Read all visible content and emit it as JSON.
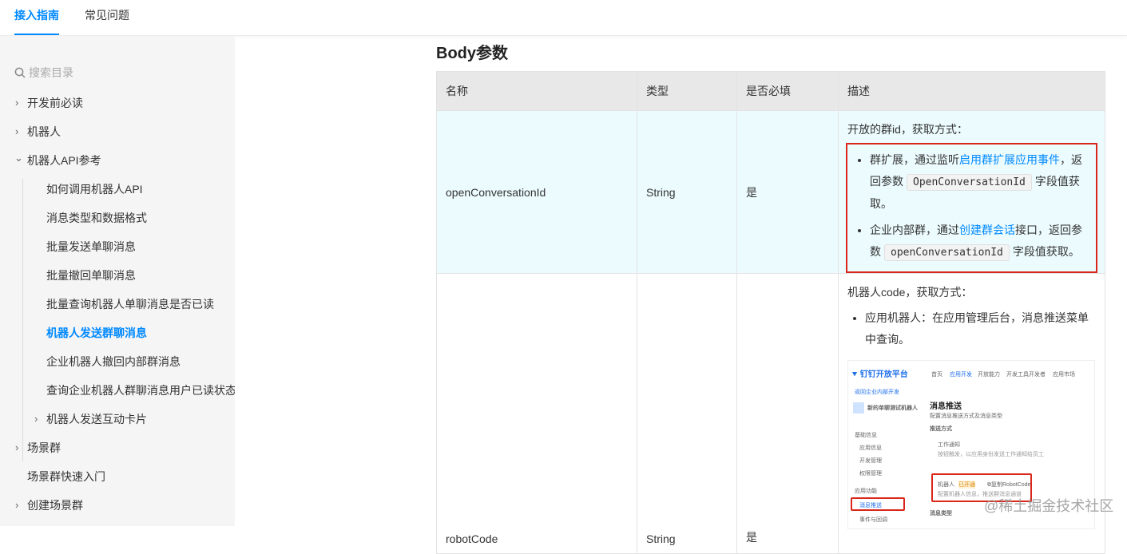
{
  "tabs": [
    {
      "label": "接入指南",
      "active": true
    },
    {
      "label": "常见问题",
      "active": false
    }
  ],
  "sidebar": {
    "search_placeholder": "搜索目录",
    "items": [
      {
        "label": "开发前必读",
        "chevron": "›"
      },
      {
        "label": "机器人",
        "chevron": "›"
      },
      {
        "label": "机器人API参考",
        "chevron": "⌄"
      },
      {
        "label": "如何调用机器人API"
      },
      {
        "label": "消息类型和数据格式"
      },
      {
        "label": "批量发送单聊消息"
      },
      {
        "label": "批量撤回单聊消息"
      },
      {
        "label": "批量查询机器人单聊消息是否已读"
      },
      {
        "label": "机器人发送群聊消息",
        "active": true
      },
      {
        "label": "企业机器人撤回内部群消息"
      },
      {
        "label": "查询企业机器人群聊消息用户已读状态"
      },
      {
        "label": "机器人发送互动卡片",
        "chevron": "›"
      },
      {
        "label": "场景群",
        "chevron": "›"
      },
      {
        "label": "场景群快速入门"
      },
      {
        "label": "创建场景群",
        "chevron": "›"
      }
    ]
  },
  "content": {
    "section_title": "Body参数",
    "headers": [
      "名称",
      "类型",
      "是否必填",
      "描述"
    ],
    "rows": [
      {
        "name": "openConversationId",
        "type": "String",
        "required": "是",
        "desc_head": "开放的群id，获取方式：",
        "bullets": [
          {
            "pre": "群扩展，通过监听",
            "link": "启用群扩展应用事件",
            "mid": "，返回参数",
            "code": "OpenConversationId",
            "post": "字段值获取。"
          },
          {
            "pre": "企业内部群，通过",
            "link": "创建群会话",
            "mid": "接口，返回参数",
            "code": "openConversationId",
            "post": "字段值获取。"
          }
        ]
      },
      {
        "name": "robotCode",
        "type": "String",
        "required": "是",
        "desc_head": "机器人code，获取方式：",
        "bullet": "应用机器人：在应用管理后台，消息推送菜单中查询。"
      }
    ]
  },
  "screenshot": {
    "logo": "钉钉开放平台",
    "nav": [
      "首页",
      "应用开发",
      "开放能力",
      "开发工具",
      "开发者",
      "应用市场"
    ],
    "back": "返回企业内部开发",
    "app_name": "新的单聊测试机器人",
    "menu": [
      "基础信息",
      "应用信息",
      "开发管理",
      "权限管理",
      "应用功能",
      "消息推送",
      "事件与回调"
    ],
    "heading": "消息推送",
    "subheading": "配置消息推送方式及消息类型",
    "section": "推送方式",
    "notice_title": "工作通知",
    "notice_desc": "按钮触发，以应用身份发送工作通知给员工",
    "robot_label": "机器人",
    "robot_badge": "已开通",
    "robot_copy": "复制RobotCode",
    "robot_desc": "配置机器人信息，推送群消息通道",
    "msg_type": "消息类型"
  },
  "watermark": "@稀土掘金技术社区",
  "colors": {
    "accent": "#0089ff",
    "highlight": "#d9271c",
    "row_bg": "#ecfbfe"
  }
}
